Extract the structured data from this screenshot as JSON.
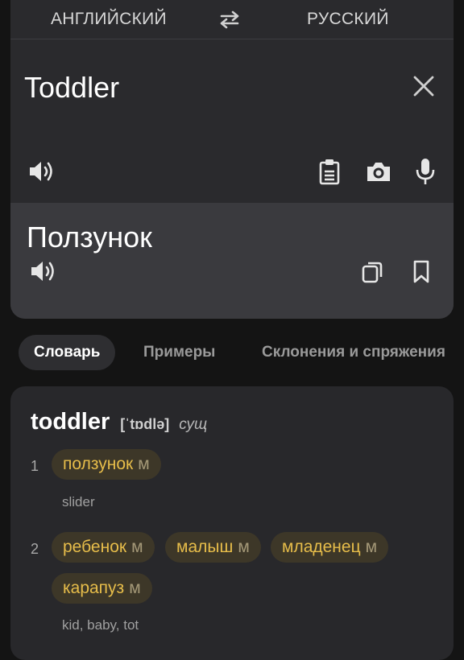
{
  "languages": {
    "source": "АНГЛИЙСКИЙ",
    "target": "РУССКИЙ"
  },
  "input": {
    "text": "Toddler"
  },
  "output": {
    "text": "Ползунок"
  },
  "tabs": [
    {
      "label": "Словарь",
      "active": true
    },
    {
      "label": "Примеры",
      "active": false
    },
    {
      "label": "Склонения и спряжения",
      "active": false
    }
  ],
  "dictionary": {
    "headword": "toddler",
    "transcription": "[ˈtɒdlə]",
    "pos": "сущ",
    "senses": [
      {
        "number": "1",
        "translations": [
          {
            "word": "ползунок",
            "gender": "м"
          }
        ],
        "gloss": "slider"
      },
      {
        "number": "2",
        "translations": [
          {
            "word": "ребенок",
            "gender": "м"
          },
          {
            "word": "малыш",
            "gender": "м"
          },
          {
            "word": "младенец",
            "gender": "м"
          },
          {
            "word": "карапуз",
            "gender": "м"
          }
        ],
        "gloss": "kid, baby, tot"
      }
    ]
  },
  "colors": {
    "background": "#141414",
    "card": "#2a2a2d",
    "result": "#3a3a3e",
    "chip_bg": "#3d3728",
    "chip_text": "#e7bd4a"
  },
  "icons": {
    "swap": "swap-arrows-icon",
    "clear": "close-icon",
    "speak": "speaker-icon",
    "paste": "clipboard-icon",
    "camera": "camera-icon",
    "mic": "microphone-icon",
    "copy": "copy-icon",
    "bookmark": "bookmark-icon"
  }
}
